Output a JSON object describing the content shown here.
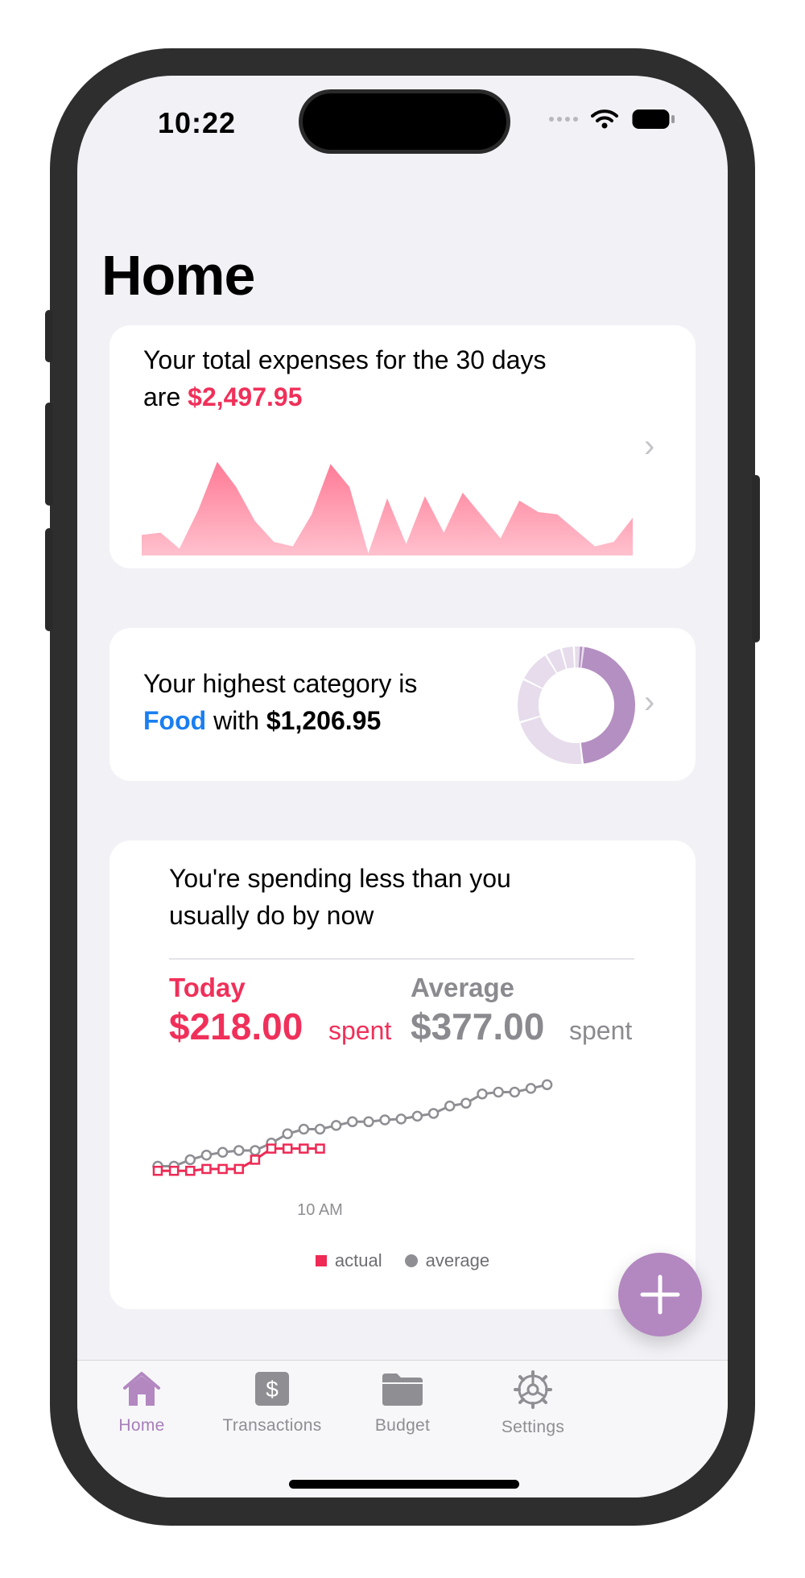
{
  "status": {
    "time": "10:22"
  },
  "page": {
    "title": "Home"
  },
  "expenses_card": {
    "line1": "Your total expenses for the 30 days",
    "line2_prefix": "are ",
    "total": "$2,497.95",
    "chart_values": [
      18,
      20,
      6,
      40,
      82,
      60,
      30,
      12,
      8,
      36,
      80,
      60,
      2,
      50,
      10,
      52,
      20,
      55,
      35,
      15,
      48,
      38,
      36,
      22,
      8,
      12,
      33
    ],
    "colors": {
      "accent": "#f0305a",
      "area_top": "#ff7a95",
      "area_bottom": "#ffc1ce"
    }
  },
  "category_card": {
    "line1": "Your highest category is",
    "category": "Food",
    "with_text": " with ",
    "amount": "$1,206.95",
    "donut_fractions": [
      0.483,
      0.22,
      0.12,
      0.09,
      0.045,
      0.035,
      0.02,
      0.012
    ],
    "colors": {
      "main": "#b48fc1",
      "minor": "#e6dceb"
    }
  },
  "spending_card": {
    "headline_line1": "You're spending less than you",
    "headline_line2": "usually do by now",
    "today_label": "Today",
    "today_value": "$218.00",
    "today_unit": "spent",
    "average_label": "Average",
    "average_value": "$377.00",
    "average_unit": "spent",
    "x_tick": "10 AM",
    "legend_actual": "actual",
    "legend_average": "average",
    "actual_series": [
      5,
      5,
      5,
      7,
      7,
      7,
      17,
      29,
      29,
      29,
      29
    ],
    "average_series": [
      10,
      10,
      17,
      22,
      25,
      27,
      27,
      35,
      45,
      50,
      50,
      54,
      58,
      58,
      60,
      61,
      64,
      67,
      75,
      78,
      88,
      90,
      90,
      94,
      98
    ]
  },
  "tabs": [
    {
      "label": "Home",
      "icon": "house-icon",
      "active": true
    },
    {
      "label": "Transactions",
      "icon": "dollar-icon",
      "active": false
    },
    {
      "label": "Budget",
      "icon": "folder-icon",
      "active": false
    },
    {
      "label": "Settings",
      "icon": "gear-icon",
      "active": false
    }
  ]
}
